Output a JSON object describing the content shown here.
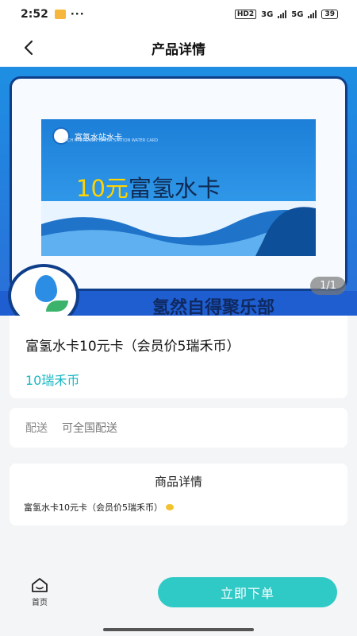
{
  "status_bar": {
    "time": "2:52",
    "dots": "···",
    "hd": "HD2",
    "net1": "3G",
    "net2": "5G",
    "battery": "39"
  },
  "header": {
    "title": "产品详情",
    "back_icon": "chevron-left-icon"
  },
  "banner": {
    "card_brand": "富氢水站水卡",
    "card_brand_sub": "RICH HYDROGEN WATER STATION WATER CARD",
    "card_amount": "10元",
    "card_title": "富氢水卡",
    "club_name": "氢然自得聚乐部",
    "counter": "1/1"
  },
  "product": {
    "name": "富氢水卡10元卡（会员价5瑞禾币）",
    "price": "10瑞禾币"
  },
  "delivery": {
    "label": "配送",
    "value": "可全国配送"
  },
  "details": {
    "heading": "商品详情",
    "text": "富氢水卡10元卡（会员价5瑞禾币）"
  },
  "bottom_bar": {
    "home_label": "首页",
    "home_icon": "home-icon",
    "order_label": "立即下单"
  },
  "colors": {
    "accent": "#2fc9c6",
    "price": "#19b8c4",
    "banner_blue": "#1e8fe3"
  }
}
